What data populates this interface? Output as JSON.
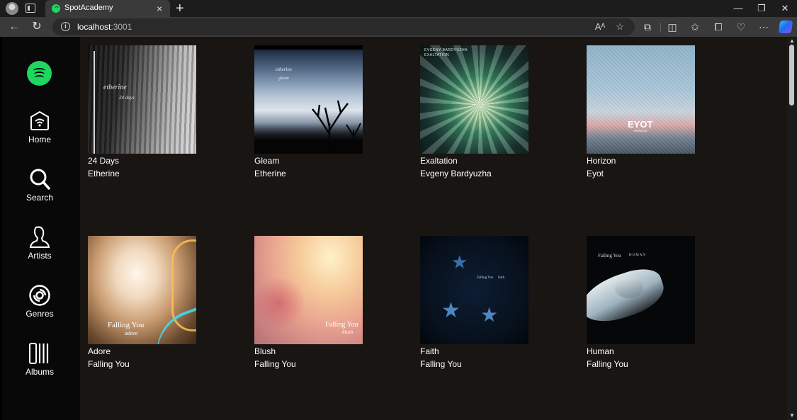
{
  "browser": {
    "tab_title": "SpotAcademy",
    "tab_close": "×",
    "new_tab": "+",
    "url_host": "localhost",
    "url_port": ":3001",
    "window_controls": {
      "minimize": "—",
      "restore": "❐",
      "close": "✕"
    },
    "toolbar_icons": [
      "read-aloud-icon",
      "favorite-star-icon",
      "extensions-icon",
      "split-screen-icon",
      "favorites-icon",
      "collections-icon",
      "browser-essentials-icon",
      "more-icon",
      "copilot-icon"
    ]
  },
  "sidebar": {
    "logo": "spotify-logo",
    "items": [
      {
        "label": "Home",
        "icon": "home-icon"
      },
      {
        "label": "Search",
        "icon": "search-icon"
      },
      {
        "label": "Artists",
        "icon": "artist-icon"
      },
      {
        "label": "Genres",
        "icon": "genres-icon"
      },
      {
        "label": "Albums",
        "icon": "albums-icon"
      }
    ]
  },
  "albums": [
    {
      "title": "24 Days",
      "artist": "Etherine",
      "cover_text": "etherine",
      "cover_sub": "24 days"
    },
    {
      "title": "Gleam",
      "artist": "Etherine",
      "cover_text": "etherine",
      "cover_sub": "gleam"
    },
    {
      "title": "Exaltation",
      "artist": "Evgeny Bardyuzha",
      "cover_text": "EVGENY BARDYUZHA",
      "cover_sub": "EXALTATION"
    },
    {
      "title": "Horizon",
      "artist": "Eyot",
      "cover_text": "EYOT",
      "cover_sub": "HORIZON"
    },
    {
      "title": "Adore",
      "artist": "Falling You",
      "cover_text": "Falling You",
      "cover_sub": "adore"
    },
    {
      "title": "Blush",
      "artist": "Falling You",
      "cover_text": "Falling You",
      "cover_sub": "blush"
    },
    {
      "title": "Faith",
      "artist": "Falling You",
      "cover_text": "Falling You",
      "cover_sub": "faith"
    },
    {
      "title": "Human",
      "artist": "Falling You",
      "cover_text": "Falling You",
      "cover_sub": "HUMAN"
    }
  ],
  "colors": {
    "accent": "#1ed760",
    "sidebar_bg": "#080808",
    "content_bg": "#181513",
    "chrome_bg": "#3a3a3a"
  }
}
